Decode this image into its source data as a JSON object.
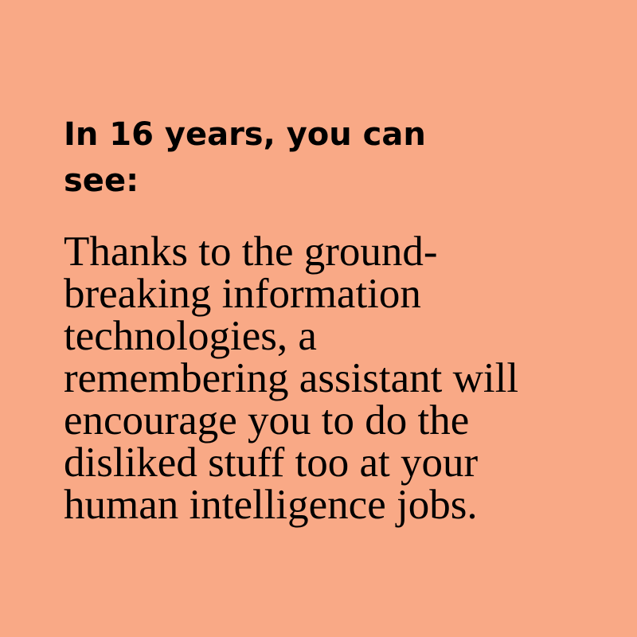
{
  "card": {
    "background_color": "#F9A986",
    "text_color": "#000000",
    "heading": "In 16 years, you can\nsee:",
    "body": "Thanks to the ground-\nbreaking information\ntechnologies, a\nremembering assistant will\nencourage you to do the\ndisliked stuff too at your\nhuman intelligence jobs."
  }
}
